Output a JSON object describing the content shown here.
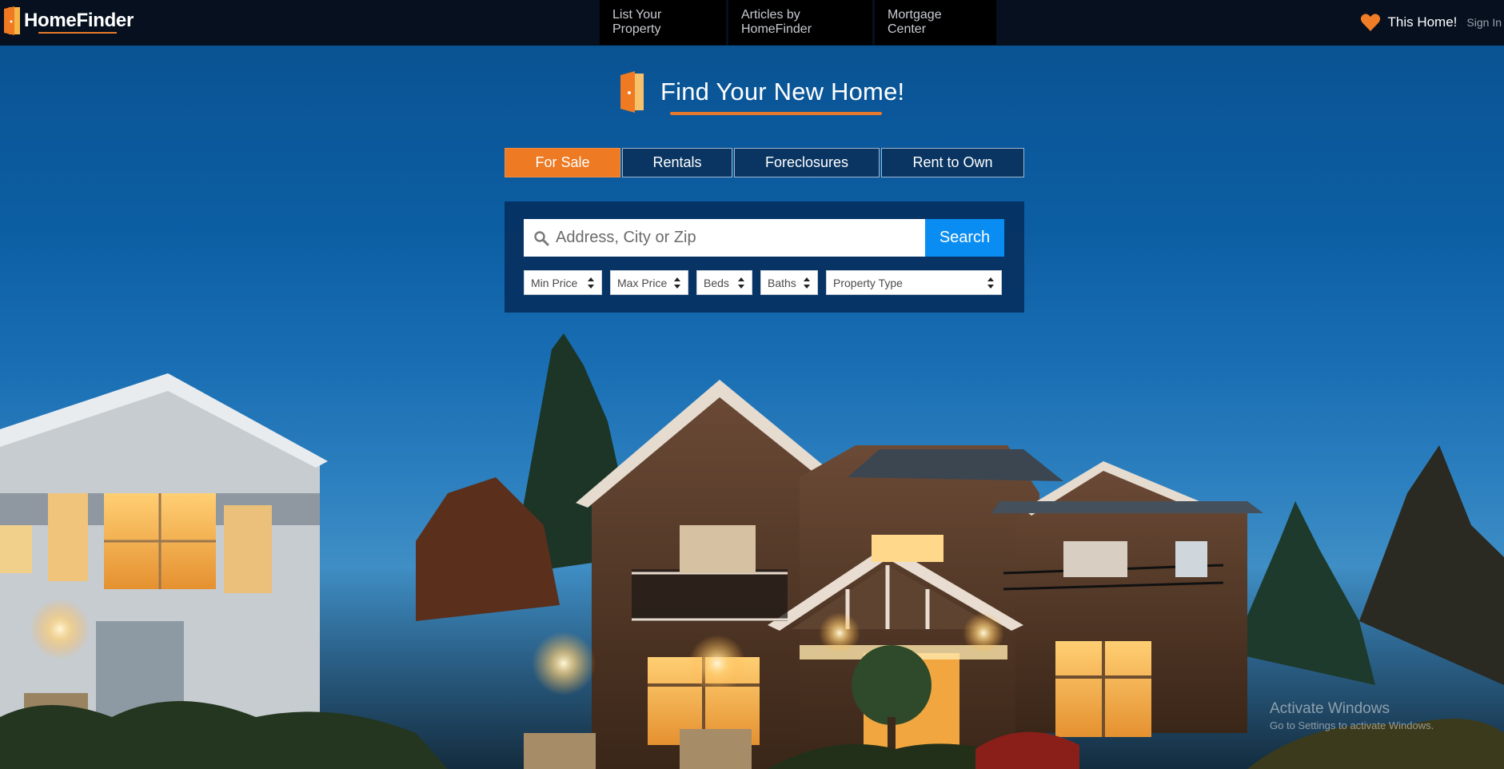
{
  "brand": {
    "name": "HomeFinder",
    "accent_color": "#e8792a",
    "door_icon": "door-icon"
  },
  "nav": {
    "links": [
      {
        "label": "List Your Property"
      },
      {
        "label": "Articles by HomeFinder"
      },
      {
        "label": "Mortgage Center"
      }
    ],
    "favorites_label": "This Home!",
    "favorites_icon": "heart-icon",
    "signin_label": "Sign In"
  },
  "hero": {
    "headline": "Find Your New Home!"
  },
  "tabs": [
    {
      "label": "For Sale",
      "active": true
    },
    {
      "label": "Rentals",
      "active": false
    },
    {
      "label": "Foreclosures",
      "active": false
    },
    {
      "label": "Rent to Own",
      "active": false
    }
  ],
  "search": {
    "placeholder": "Address, City or Zip",
    "value": "",
    "button_label": "Search",
    "button_color": "#0a8df2",
    "icon": "search-icon"
  },
  "filters": [
    {
      "label": "Min Price"
    },
    {
      "label": "Max Price"
    },
    {
      "label": "Beds"
    },
    {
      "label": "Baths"
    },
    {
      "label": "Property Type"
    }
  ],
  "watermark": {
    "title": "Activate Windows",
    "subtitle": "Go to Settings to activate Windows."
  }
}
